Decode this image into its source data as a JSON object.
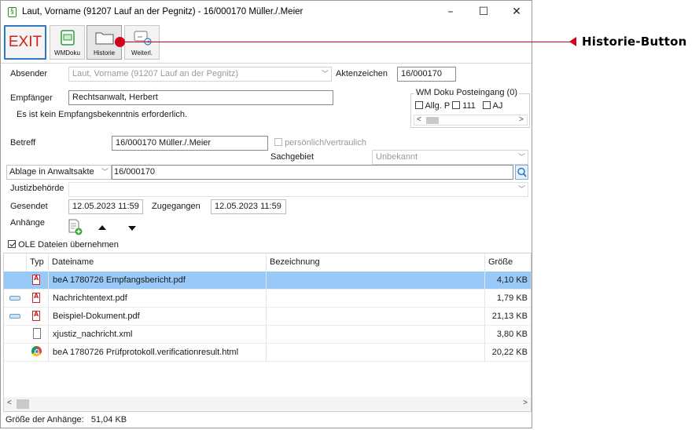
{
  "window": {
    "title": "Laut, Vorname (91207 Lauf an der Pegnitz) - 16/000170  Müller./.Meier",
    "app_icon_glyph": "§",
    "controls": {
      "minimize": "–",
      "maximize": "☐",
      "close": "✕"
    }
  },
  "toolbar": {
    "exit_label": "EXIT",
    "buttons": [
      {
        "label": "WMDoku",
        "icon": "green-document-icon"
      },
      {
        "label": "Historie",
        "icon": "folder-icon"
      },
      {
        "label": "Weiterl.",
        "icon": "forward-icon"
      }
    ]
  },
  "annotation": {
    "text": "Historie-Button",
    "color": "#d0021b"
  },
  "form": {
    "absender_label": "Absender",
    "absender_value": "Laut, Vorname (91207 Lauf an der Pegnitz)",
    "aktenzeichen_label": "Aktenzeichen",
    "aktenzeichen_value": "16/000170",
    "empfaenger_label": "Empfänger",
    "empfaenger_value": "Rechtsanwalt, Herbert",
    "empfang_notice": "Es ist kein Empfangsbekenntnis erforderlich.",
    "wm_doku_title": "WM Doku Posteingang (0)",
    "wm_doku_checks": [
      "Allg. P",
      "111",
      "AJ"
    ],
    "betreff_label": "Betreff",
    "betreff_value": "16/000170  Müller./.Meier",
    "persoenlich_label": "persönlich/vertraulich",
    "sachgebiet_label": "Sachgebiet",
    "sachgebiet_value": "Unbekannt",
    "ablage_value": "Ablage in Anwaltsakte",
    "ablage_akte": "16/000170",
    "justizbehoerde_label": "Justizbehörde",
    "gesendet_label": "Gesendet",
    "gesendet_value": "12.05.2023 11:59",
    "zugegangen_label": "Zugegangen",
    "zugegangen_value": "12.05.2023 11:59",
    "anhaenge_label": "Anhänge",
    "ole_label": "OLE Dateien übernehmen",
    "ole_checked": true
  },
  "table": {
    "columns": [
      "Typ",
      "Dateiname",
      "Bezeichnung",
      "Größe"
    ],
    "rows": [
      {
        "attach_icon": false,
        "type_icon": "pdf-icon",
        "name": "beA 1780726 Empfangsbericht.pdf",
        "desc": "",
        "size": "4,10 KB",
        "selected": true
      },
      {
        "attach_icon": true,
        "type_icon": "pdf-icon",
        "name": "Nachrichtentext.pdf",
        "desc": "",
        "size": "1,79 KB",
        "selected": false
      },
      {
        "attach_icon": true,
        "type_icon": "pdf-icon",
        "name": "Beispiel-Dokument.pdf",
        "desc": "",
        "size": "21,13 KB",
        "selected": false
      },
      {
        "attach_icon": false,
        "type_icon": "xml-file-icon",
        "name": "xjustiz_nachricht.xml",
        "desc": "",
        "size": "3,80 KB",
        "selected": false
      },
      {
        "attach_icon": false,
        "type_icon": "chrome-icon",
        "name": "beA 1780726 Prüfprotokoll.verificationresult.html",
        "desc": "",
        "size": "20,22 KB",
        "selected": false
      }
    ]
  },
  "status": {
    "label": "Größe der Anhänge:",
    "value": "51,04 KB"
  }
}
